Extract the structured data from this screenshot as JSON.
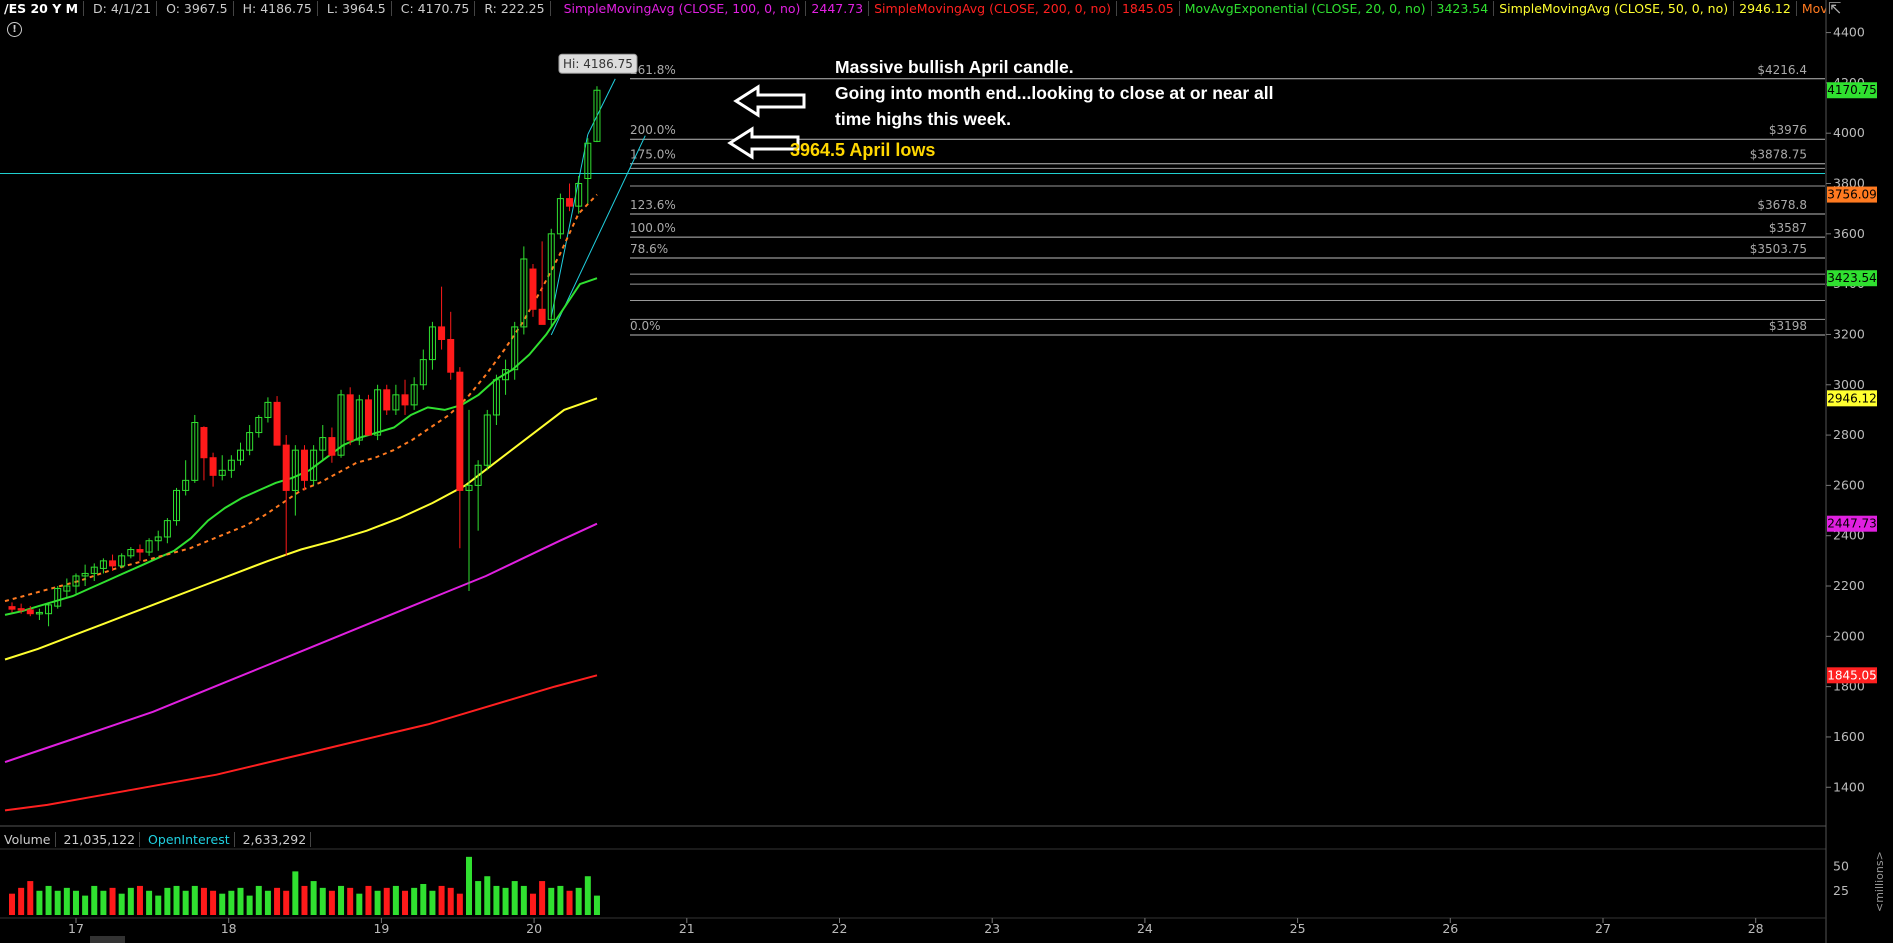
{
  "header": {
    "symbol": "/ES 20 Y M",
    "date": "D: 4/1/21",
    "open": "O: 3967.5",
    "high": "H: 4186.75",
    "low": "L: 3964.5",
    "close": "C: 4170.75",
    "range": "R: 222.25",
    "studies": [
      {
        "label": "SimpleMovingAvg (CLOSE, 100, 0, no)",
        "value": "2447.73",
        "color": "#e020e0"
      },
      {
        "label": "SimpleMovingAvg (CLOSE, 200, 0, no)",
        "value": "1845.05",
        "color": "#ff2020"
      },
      {
        "label": "MovAvgExponential (CLOSE, 20, 0, no)",
        "value": "3423.54",
        "color": "#30e030"
      },
      {
        "label": "SimpleMovingAvg (CLOSE, 50, 0, no)",
        "value": "2946.12",
        "color": "#ffff30"
      },
      {
        "label": "MovAvgExponential (CLOSE, 8, 0, no)",
        "value": "3756.09",
        "color": "#ff7a20"
      }
    ],
    "more": "..."
  },
  "annotations": {
    "main_line1": "Massive bullish April candle.",
    "main_line2": "Going into month end...looking to close at or near all",
    "main_line3": "time highs this week.",
    "lows_label": "3964.5 April lows",
    "hi_tooltip": "Hi: 4186.75"
  },
  "volume": {
    "label": "Volume",
    "value": "21,035,122",
    "oi_label": "OpenInterest",
    "oi_value": "2,633,292",
    "axis_unit": "<millions>"
  },
  "chart_data": {
    "type": "candlestick",
    "title": "",
    "x_axis_ticks": [
      "17",
      "18",
      "19",
      "20",
      "21",
      "22",
      "23",
      "24",
      "25",
      "26",
      "27",
      "28"
    ],
    "ylim": [
      1250,
      4450
    ],
    "y_ticks": [
      1400,
      1600,
      1800,
      2000,
      2200,
      2400,
      2600,
      2800,
      3000,
      3200,
      3400,
      3600,
      3800,
      4000,
      4200,
      4400
    ],
    "horizontal_line": 3840,
    "candles": [
      {
        "o": 2118,
        "h": 2135,
        "l": 2095,
        "c": 2108
      },
      {
        "o": 2110,
        "h": 2130,
        "l": 2090,
        "c": 2105
      },
      {
        "o": 2105,
        "h": 2120,
        "l": 2080,
        "c": 2090
      },
      {
        "o": 2090,
        "h": 2110,
        "l": 2065,
        "c": 2095
      },
      {
        "o": 2090,
        "h": 2135,
        "l": 2040,
        "c": 2125
      },
      {
        "o": 2120,
        "h": 2200,
        "l": 2110,
        "c": 2190
      },
      {
        "o": 2180,
        "h": 2230,
        "l": 2155,
        "c": 2200
      },
      {
        "o": 2200,
        "h": 2250,
        "l": 2170,
        "c": 2240
      },
      {
        "o": 2240,
        "h": 2285,
        "l": 2200,
        "c": 2250
      },
      {
        "o": 2250,
        "h": 2290,
        "l": 2220,
        "c": 2275
      },
      {
        "o": 2270,
        "h": 2310,
        "l": 2250,
        "c": 2300
      },
      {
        "o": 2300,
        "h": 2325,
        "l": 2260,
        "c": 2280
      },
      {
        "o": 2280,
        "h": 2330,
        "l": 2270,
        "c": 2320
      },
      {
        "o": 2320,
        "h": 2355,
        "l": 2310,
        "c": 2345
      },
      {
        "o": 2345,
        "h": 2365,
        "l": 2300,
        "c": 2335
      },
      {
        "o": 2335,
        "h": 2390,
        "l": 2320,
        "c": 2380
      },
      {
        "o": 2380,
        "h": 2420,
        "l": 2340,
        "c": 2395
      },
      {
        "o": 2395,
        "h": 2470,
        "l": 2370,
        "c": 2460
      },
      {
        "o": 2460,
        "h": 2590,
        "l": 2440,
        "c": 2580
      },
      {
        "o": 2580,
        "h": 2700,
        "l": 2560,
        "c": 2620
      },
      {
        "o": 2620,
        "h": 2880,
        "l": 2610,
        "c": 2850
      },
      {
        "o": 2830,
        "h": 2835,
        "l": 2620,
        "c": 2710
      },
      {
        "o": 2710,
        "h": 2730,
        "l": 2595,
        "c": 2640
      },
      {
        "o": 2640,
        "h": 2720,
        "l": 2620,
        "c": 2660
      },
      {
        "o": 2660,
        "h": 2720,
        "l": 2630,
        "c": 2700
      },
      {
        "o": 2700,
        "h": 2770,
        "l": 2680,
        "c": 2740
      },
      {
        "o": 2740,
        "h": 2840,
        "l": 2720,
        "c": 2810
      },
      {
        "o": 2810,
        "h": 2880,
        "l": 2790,
        "c": 2870
      },
      {
        "o": 2870,
        "h": 2950,
        "l": 2850,
        "c": 2930
      },
      {
        "o": 2930,
        "h": 2955,
        "l": 2760,
        "c": 2760
      },
      {
        "o": 2760,
        "h": 2800,
        "l": 2320,
        "c": 2580
      },
      {
        "o": 2580,
        "h": 2760,
        "l": 2480,
        "c": 2740
      },
      {
        "o": 2740,
        "h": 2760,
        "l": 2580,
        "c": 2620
      },
      {
        "o": 2620,
        "h": 2760,
        "l": 2600,
        "c": 2740
      },
      {
        "o": 2740,
        "h": 2840,
        "l": 2700,
        "c": 2790
      },
      {
        "o": 2790,
        "h": 2830,
        "l": 2690,
        "c": 2720
      },
      {
        "o": 2720,
        "h": 2980,
        "l": 2710,
        "c": 2960
      },
      {
        "o": 2960,
        "h": 2990,
        "l": 2760,
        "c": 2780
      },
      {
        "o": 2780,
        "h": 2960,
        "l": 2760,
        "c": 2940
      },
      {
        "o": 2940,
        "h": 2960,
        "l": 2800,
        "c": 2800
      },
      {
        "o": 2800,
        "h": 3000,
        "l": 2780,
        "c": 2980
      },
      {
        "o": 2980,
        "h": 3000,
        "l": 2880,
        "c": 2900
      },
      {
        "o": 2900,
        "h": 3000,
        "l": 2880,
        "c": 2960
      },
      {
        "o": 2960,
        "h": 3020,
        "l": 2880,
        "c": 2920
      },
      {
        "o": 2920,
        "h": 3030,
        "l": 2900,
        "c": 3000
      },
      {
        "o": 3000,
        "h": 3140,
        "l": 2980,
        "c": 3100
      },
      {
        "o": 3100,
        "h": 3250,
        "l": 3060,
        "c": 3230
      },
      {
        "o": 3230,
        "h": 3390,
        "l": 3140,
        "c": 3180
      },
      {
        "o": 3180,
        "h": 3290,
        "l": 3020,
        "c": 3050
      },
      {
        "o": 3050,
        "h": 3070,
        "l": 2350,
        "c": 2580
      },
      {
        "o": 2580,
        "h": 2900,
        "l": 2180,
        "c": 2600
      },
      {
        "o": 2600,
        "h": 2700,
        "l": 2420,
        "c": 2680
      },
      {
        "o": 2680,
        "h": 2900,
        "l": 2660,
        "c": 2880
      },
      {
        "o": 2880,
        "h": 3040,
        "l": 2840,
        "c": 3020
      },
      {
        "o": 3020,
        "h": 3100,
        "l": 2960,
        "c": 3060
      },
      {
        "o": 3060,
        "h": 3250,
        "l": 3020,
        "c": 3230
      },
      {
        "o": 3230,
        "h": 3550,
        "l": 3200,
        "c": 3500
      },
      {
        "o": 3460,
        "h": 3480,
        "l": 3270,
        "c": 3300
      },
      {
        "o": 3300,
        "h": 3570,
        "l": 3240,
        "c": 3240
      },
      {
        "o": 3260,
        "h": 3620,
        "l": 3230,
        "c": 3600
      },
      {
        "o": 3600,
        "h": 3760,
        "l": 3580,
        "c": 3740
      },
      {
        "o": 3740,
        "h": 3800,
        "l": 3690,
        "c": 3710
      },
      {
        "o": 3710,
        "h": 3830,
        "l": 3680,
        "c": 3800
      },
      {
        "o": 3820,
        "h": 3980,
        "l": 3720,
        "c": 3960
      },
      {
        "o": 3967.5,
        "h": 4186.75,
        "l": 3964.5,
        "c": 4170.75
      }
    ],
    "ema8": [
      2140,
      2160,
      2180,
      2200,
      2220,
      2245,
      2270,
      2290,
      2310,
      2330,
      2350,
      2380,
      2410,
      2440,
      2480,
      2530,
      2580,
      2610,
      2650,
      2690,
      2710,
      2740,
      2780,
      2830,
      2880,
      2950,
      3040,
      3140,
      3250,
      3380,
      3520,
      3680,
      3756.09
    ],
    "ema20": [
      2085,
      2100,
      2120,
      2140,
      2160,
      2190,
      2220,
      2250,
      2280,
      2310,
      2340,
      2390,
      2460,
      2510,
      2550,
      2580,
      2610,
      2630,
      2660,
      2710,
      2760,
      2790,
      2810,
      2830,
      2880,
      2910,
      2900,
      2920,
      2960,
      3020,
      3060,
      3120,
      3200,
      3300,
      3400,
      3423.54
    ],
    "sma50": [
      1908,
      1950,
      2000,
      2050,
      2100,
      2150,
      2200,
      2250,
      2300,
      2345,
      2380,
      2420,
      2470,
      2530,
      2600,
      2700,
      2800,
      2900,
      2946.12
    ],
    "sma100": [
      1500,
      1550,
      1600,
      1650,
      1700,
      1760,
      1820,
      1880,
      1940,
      2000,
      2060,
      2120,
      2180,
      2240,
      2310,
      2380,
      2447.73
    ],
    "sma200": [
      1308,
      1330,
      1360,
      1390,
      1420,
      1450,
      1490,
      1530,
      1570,
      1610,
      1650,
      1700,
      1750,
      1800,
      1845.05
    ],
    "fib_levels": [
      {
        "label": "261.8%",
        "value": 4216.4,
        "price": "$4216.4"
      },
      {
        "label": "200.0%",
        "value": 3976,
        "price": "$3976"
      },
      {
        "label": "175.0%",
        "value": 3878.75,
        "price": "$3878.75"
      },
      {
        "label": "123.6%",
        "value": 3678.8,
        "price": "$3678.8"
      },
      {
        "label": "100.0%",
        "value": 3587,
        "price": "$3587"
      },
      {
        "label": "78.6%",
        "value": 3503.75,
        "price": "$3503.75"
      },
      {
        "label": "0.0%",
        "value": 3198,
        "price": "$3198"
      }
    ],
    "extra_levels": [
      3860,
      3790,
      3440,
      3400,
      3335,
      3260
    ],
    "price_badges": [
      {
        "value": "4170.75",
        "color": "#30e030",
        "text_color": "#000"
      },
      {
        "value": "3756.09",
        "color": "#ff7a20",
        "text_color": "#000"
      },
      {
        "value": "3423.54",
        "color": "#30e030",
        "text_color": "#000"
      },
      {
        "value": "2946.12",
        "color": "#ffff30",
        "text_color": "#000"
      },
      {
        "value": "2447.73",
        "color": "#e020e0",
        "text_color": "#000"
      },
      {
        "value": "1845.05",
        "color": "#ff2020",
        "text_color": "#fff"
      }
    ],
    "volume_ticks": [
      25,
      50
    ],
    "volume_bars": [
      22,
      28,
      35,
      25,
      30,
      25,
      28,
      25,
      20,
      30,
      25,
      28,
      22,
      28,
      30,
      25,
      20,
      28,
      30,
      25,
      30,
      28,
      25,
      22,
      25,
      28,
      20,
      30,
      25,
      28,
      25,
      45,
      30,
      35,
      28,
      25,
      30,
      28,
      22,
      30,
      25,
      28,
      30,
      25,
      28,
      32,
      25,
      30,
      28,
      22,
      60,
      35,
      40,
      30,
      28,
      35,
      30,
      22,
      35,
      28,
      30,
      25,
      28,
      40,
      20
    ]
  }
}
